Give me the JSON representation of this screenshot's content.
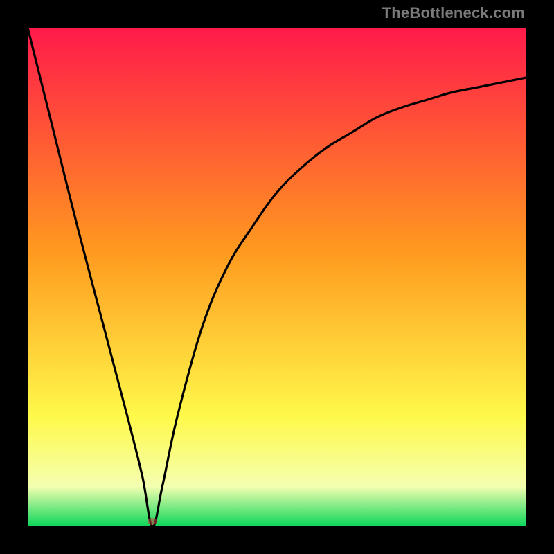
{
  "watermark": "TheBottleneck.com",
  "colors": {
    "black": "#000000",
    "red_top": "#ff1a4a",
    "orange_mid": "#ff9a1f",
    "yellow": "#fff94a",
    "pale": "#f4ffb0",
    "green": "#0bd659",
    "curve": "#000000",
    "marker": "rgba(200,70,70,0.55)"
  },
  "chart_data": {
    "type": "line",
    "title": "",
    "xlabel": "",
    "ylabel": "",
    "xlim": [
      0,
      100
    ],
    "ylim": [
      0,
      100
    ],
    "grid": false,
    "legend": false,
    "series": [
      {
        "name": "bottleneck-curve",
        "x": [
          0,
          5,
          10,
          15,
          20,
          23,
          25,
          27,
          30,
          35,
          40,
          45,
          50,
          55,
          60,
          65,
          70,
          75,
          80,
          85,
          90,
          95,
          100
        ],
        "y": [
          100,
          80,
          60,
          41,
          22,
          10,
          0,
          8,
          22,
          40,
          52,
          60,
          67,
          72,
          76,
          79,
          82,
          84,
          85.5,
          87,
          88,
          89,
          90
        ]
      }
    ],
    "min_point": {
      "x": 25,
      "y": 0
    },
    "marker": {
      "x": 25,
      "y": 1
    },
    "gradient_stops": [
      {
        "pos": 0.0,
        "color": "#ff1a4a"
      },
      {
        "pos": 0.45,
        "color": "#ff9a1f"
      },
      {
        "pos": 0.78,
        "color": "#fff94a"
      },
      {
        "pos": 0.92,
        "color": "#f4ffb0"
      },
      {
        "pos": 1.0,
        "color": "#0bd659"
      }
    ]
  }
}
